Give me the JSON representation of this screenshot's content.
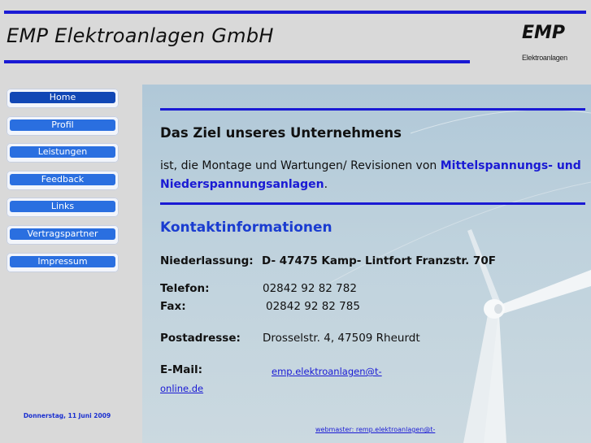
{
  "header": {
    "company_name": "EMP Elektroanlagen GmbH",
    "logo_text": "EMP",
    "logo_subtext": "Elektroanlagen"
  },
  "nav": {
    "items": [
      {
        "label": "Home"
      },
      {
        "label": "Profil"
      },
      {
        "label": "Leistungen"
      },
      {
        "label": "Feedback"
      },
      {
        "label": "Links"
      },
      {
        "label": "Vertragspartner"
      },
      {
        "label": "Impressum"
      }
    ],
    "date": "Donnerstag, 11 Juni 2009"
  },
  "content": {
    "heading": "Das Ziel unseres Unternehmens",
    "intro_prefix": "ist, die Montage und Wartungen/ Revisionen von ",
    "intro_highlight": "Mittelspannungs- und Niederspannungsanlagen",
    "intro_suffix": ".",
    "contact_heading": "Kontaktinformationen",
    "niederlassung_label": "Niederlassung:",
    "niederlassung_value": "D- 47475 Kamp- Lintfort  Franzstr. 70F",
    "telefon_label": "Telefon:",
    "telefon_value": "02842 92 82 782",
    "fax_label": "Fax:",
    "fax_value": "02842 92 82 785",
    "postadresse_label": "Postadresse:",
    "postadresse_value": "Drosselstr. 4, 47509 Rheurdt",
    "email_label": "E-Mail:",
    "email_part1": "emp.elektroanlagen@t-",
    "email_part2": "online.de",
    "webmaster": "webmaster: remp.elektroanlagen@t-"
  },
  "colors": {
    "accent": "#1a1ad4",
    "button": "#2a6fe0",
    "sidebar": "#d9d9d9"
  }
}
